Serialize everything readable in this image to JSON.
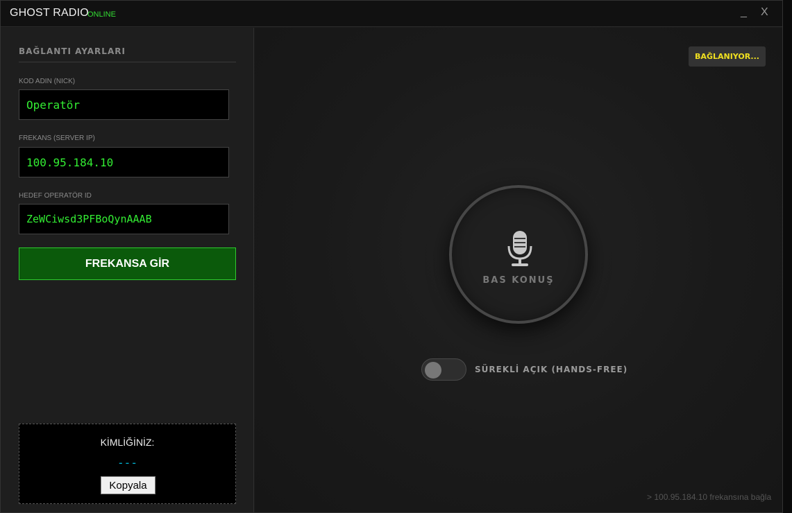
{
  "titlebar": {
    "title": "GHOST RADIO",
    "status": "ONLINE",
    "minimize_label": "_",
    "close_label": "X"
  },
  "sidebar": {
    "section_title": "BAĞLANTI AYARLARI",
    "fields": [
      {
        "label": "KOD ADIN (NICK)",
        "value": "Operatör"
      },
      {
        "label": "FREKANS (SERVER IP)",
        "value": "100.95.184.10"
      },
      {
        "label": "HEDEF OPERATÖR ID",
        "value": "ZeWCiwsd3PFBoQynAAAB"
      }
    ],
    "join_button": "FREKANSA GİR",
    "identity": {
      "label": "KİMLİĞİNİZ:",
      "value": "---",
      "copy_button": "Kopyala"
    }
  },
  "main": {
    "connection_status": "BAĞLANIYOR...",
    "ptt_label": "BAS KONUŞ",
    "ptt_icon": "microphone-icon",
    "hands_free": {
      "label": "SÜREKLİ AÇIK (HANDS-FREE)",
      "enabled": false
    },
    "log_line": "> 100.95.184.10 frekansına bağla"
  },
  "colors": {
    "accent_green": "#33ee33",
    "online_green": "#33dd33",
    "join_bg": "#0b5a0b",
    "status_yellow": "#f0e020",
    "id_cyan": "#00b7d8"
  }
}
